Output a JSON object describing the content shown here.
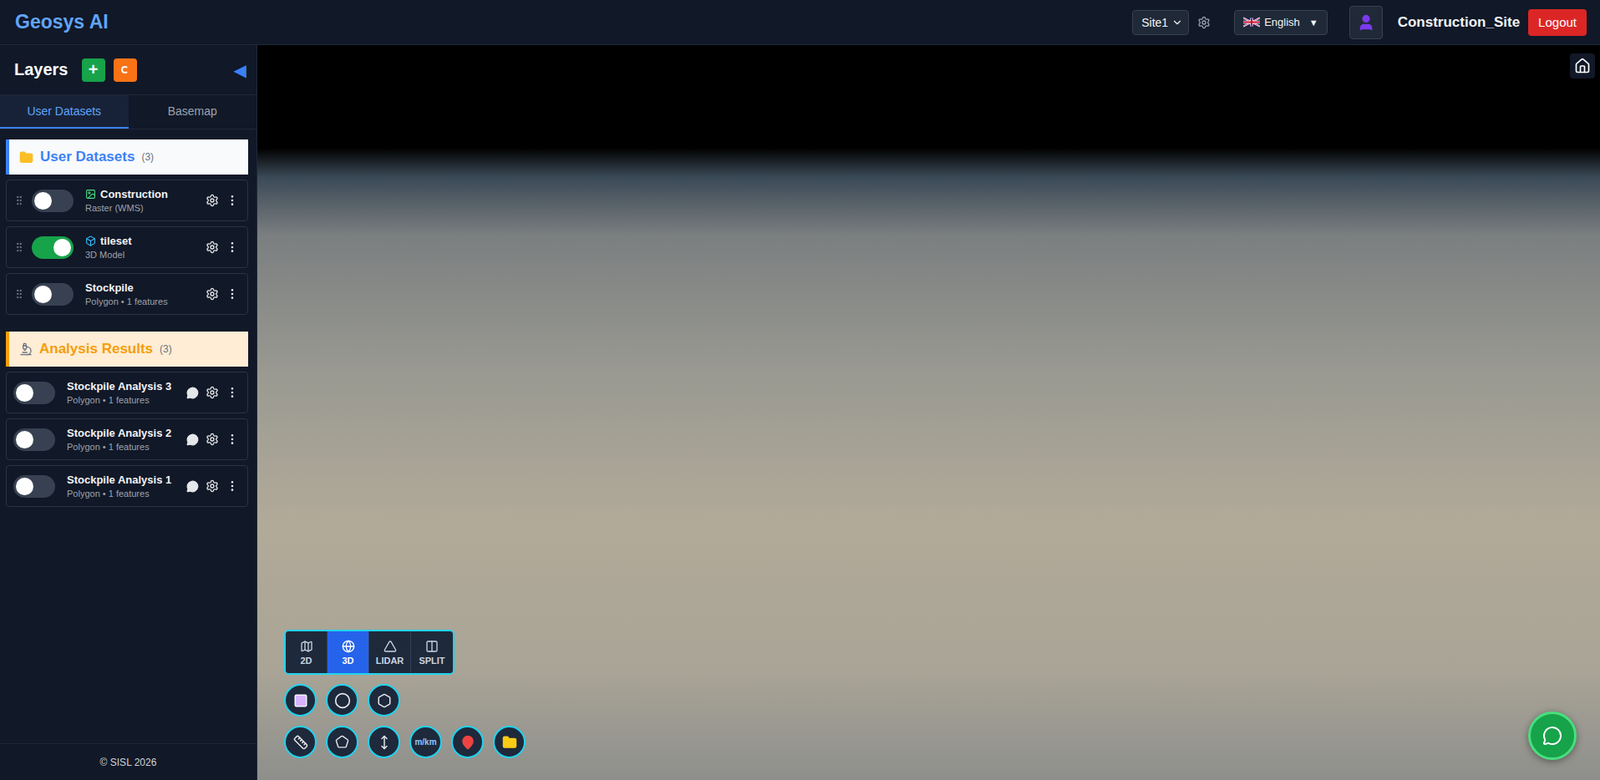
{
  "header": {
    "logo": "Geosys AI",
    "site_select": {
      "value": "Site1"
    },
    "language": {
      "label": "English",
      "caret": "▼"
    },
    "user": {
      "name": "Construction_Site"
    },
    "logout": "Logout"
  },
  "sidebar": {
    "title": "Layers",
    "add_label": "+",
    "collapse_label": "◀",
    "tabs": [
      {
        "label": "User Datasets",
        "selected": true
      },
      {
        "label": "Basemap",
        "selected": false
      }
    ],
    "groups": [
      {
        "title": "User Datasets",
        "count": "(3)",
        "kind": "datasets",
        "items": [
          {
            "name": "Construction",
            "subtitle": "Raster (WMS)",
            "kind": "raster",
            "on": false,
            "comments": false
          },
          {
            "name": "tileset",
            "subtitle": "3D Model",
            "kind": "model",
            "on": true,
            "comments": false
          },
          {
            "name": "Stockpile",
            "subtitle": "Polygon • 1 features",
            "kind": "polygon",
            "on": false,
            "comments": false
          }
        ]
      },
      {
        "title": "Analysis Results",
        "count": "(3)",
        "kind": "analysis",
        "items": [
          {
            "name": "Stockpile Analysis 3",
            "subtitle": "Polygon • 1 features",
            "kind": "polygon",
            "on": false,
            "comments": true
          },
          {
            "name": "Stockpile Analysis 2",
            "subtitle": "Polygon • 1 features",
            "kind": "polygon",
            "on": false,
            "comments": true
          },
          {
            "name": "Stockpile Analysis 1",
            "subtitle": "Polygon • 1 features",
            "kind": "polygon",
            "on": false,
            "comments": true
          }
        ]
      }
    ],
    "footer": "© SISL 2026"
  },
  "map": {
    "view_modes": [
      {
        "label": "2D",
        "selected": false
      },
      {
        "label": "3D",
        "selected": true
      },
      {
        "label": "LIDAR",
        "selected": false
      },
      {
        "label": "SPLIT",
        "selected": false
      }
    ],
    "draw_tools": [
      {
        "kind": "rectangle"
      },
      {
        "kind": "circle"
      },
      {
        "kind": "polygon"
      }
    ],
    "measure_tools": [
      {
        "kind": "distance"
      },
      {
        "kind": "area"
      },
      {
        "kind": "height"
      },
      {
        "kind": "units",
        "label": "m/km"
      },
      {
        "kind": "marker"
      },
      {
        "kind": "folder"
      }
    ]
  }
}
